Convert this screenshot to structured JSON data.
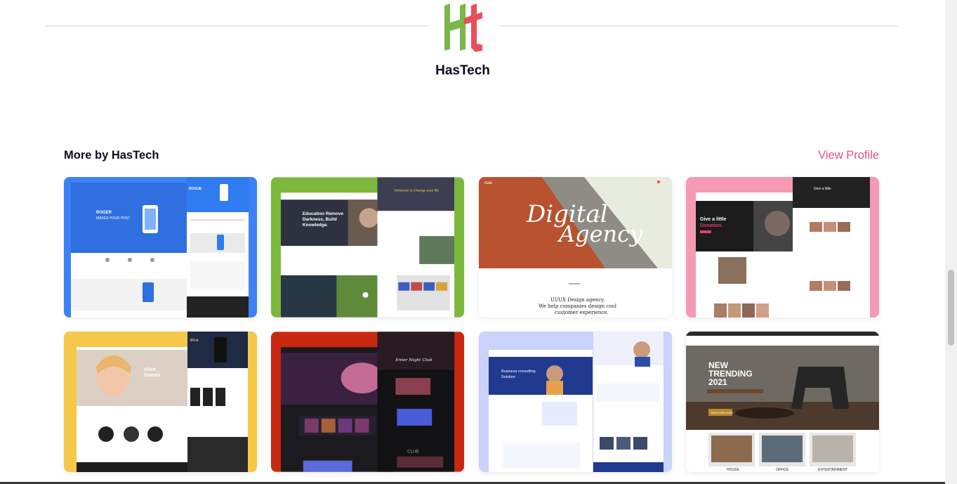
{
  "brand": {
    "name": "HasTech",
    "logo_colors": {
      "h": "#7ab648",
      "t": "#e8505b"
    }
  },
  "section": {
    "title": "More by HasTech",
    "view_profile_label": "View Profile"
  },
  "shots": [
    {
      "name": "roger-app-landing",
      "accent": "#3b82f6",
      "text": [
        "ROGER",
        "MAKES YOUR POST",
        "ROGUE"
      ]
    },
    {
      "name": "education-template",
      "accent": "#7cb83b",
      "text": [
        "Education Remove",
        "Darkness, Build",
        "Knowledge.",
        "Welcome to Change your life"
      ]
    },
    {
      "name": "digital-agency",
      "accent": "#c98c6b",
      "text": [
        "naix",
        "Digital",
        "Agency",
        "naix",
        "welcome",
        "UI/UX Design agency.",
        "We help companies design cool",
        "customer experience."
      ]
    },
    {
      "name": "charity-template",
      "accent": "#f59ab4",
      "text": [
        "Give a little",
        "Donation.",
        "Give a little"
      ]
    },
    {
      "name": "portfolio-alice",
      "accent": "#f5c84a",
      "text": [
        "Alice",
        "Gomez",
        "tri-o"
      ]
    },
    {
      "name": "night-club",
      "accent": "#c8280f",
      "text": [
        "Enter Night Club",
        "CLUB"
      ]
    },
    {
      "name": "business-consulting",
      "accent": "#c9d3fb",
      "text": [
        "Business consulting",
        "Solution"
      ]
    },
    {
      "name": "furniture-store",
      "accent": "#2a2a2a",
      "text": [
        "NEW",
        "TRENDING",
        "2021",
        "HOUSE",
        "OFFICE",
        "ENTERTAINMENT",
        "DISCOVER NOW"
      ]
    }
  ]
}
